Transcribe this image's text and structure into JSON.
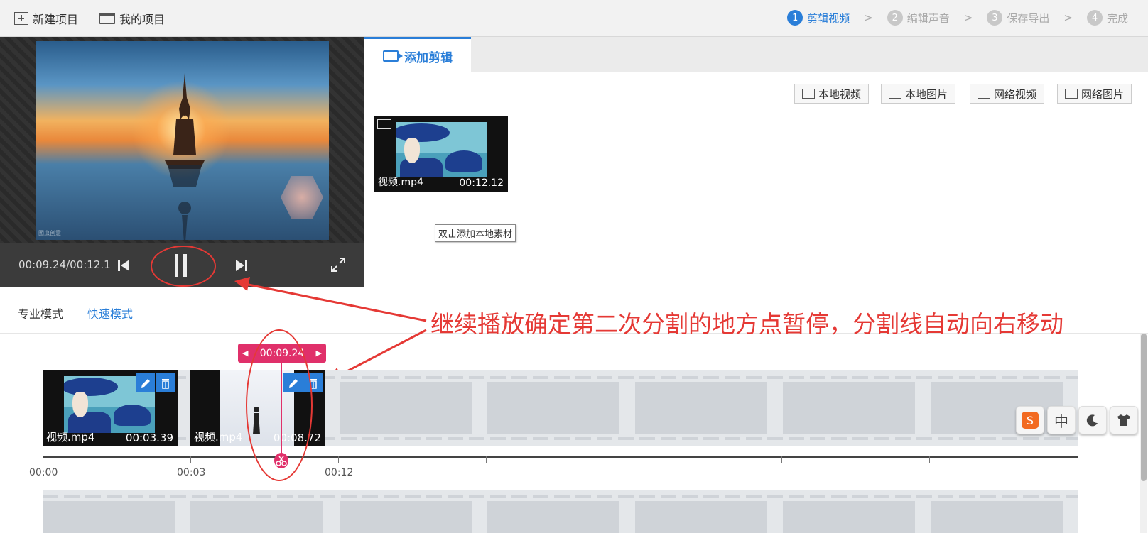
{
  "topbar": {
    "new_project": "新建项目",
    "my_projects": "我的项目",
    "steps": [
      {
        "num": "1",
        "label": "剪辑视频"
      },
      {
        "num": "2",
        "label": "编辑声音"
      },
      {
        "num": "3",
        "label": "保存导出"
      },
      {
        "num": "4",
        "label": "完成"
      }
    ]
  },
  "player": {
    "timecode": "00:09.24/00:12.1",
    "watermark": "图虫创意"
  },
  "panel": {
    "tab": "添加剪辑",
    "sources": [
      "本地视频",
      "本地图片",
      "网络视频",
      "网络图片"
    ],
    "clip": {
      "name": "视频.mp4",
      "duration": "00:12.12"
    },
    "tooltip": "双击添加本地素材"
  },
  "modes": {
    "pro": "专业模式",
    "quick": "快速模式"
  },
  "annotation": "继续播放确定第二次分割的地方点暂停，分割线自动向右移动",
  "timeline": {
    "cut_time": "00:09.24",
    "clips": [
      {
        "name": "视频.mp4",
        "duration": "00:03.39"
      },
      {
        "name": "视频.mp4",
        "duration": "00:08.72"
      }
    ],
    "ticks": [
      "00:00",
      "00:03",
      "00:12"
    ]
  },
  "ime": {
    "lang": "中"
  },
  "colors": {
    "accent": "#2a7ed8",
    "cut": "#e0306a",
    "annotation": "#e53935"
  }
}
